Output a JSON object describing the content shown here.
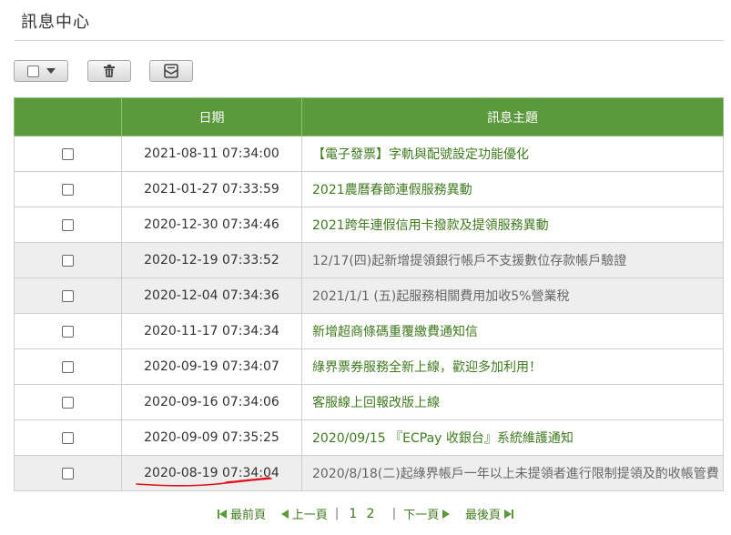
{
  "page": {
    "title": "訊息中心"
  },
  "table": {
    "headers": {
      "date": "日期",
      "subject": "訊息主題"
    },
    "rows": [
      {
        "date": "2021-08-11 07:34:00",
        "subject": "【電子發票】字軌與配號設定功能優化",
        "read": false
      },
      {
        "date": "2021-01-27 07:33:59",
        "subject": "2021農曆春節連假服務異動",
        "read": false
      },
      {
        "date": "2020-12-30 07:34:46",
        "subject": "2021跨年連假信用卡撥款及提領服務異動",
        "read": false
      },
      {
        "date": "2020-12-19 07:33:52",
        "subject": "12/17(四)起新增提領銀行帳戶不支援數位存款帳戶驗證",
        "read": true
      },
      {
        "date": "2020-12-04 07:34:36",
        "subject": "2021/1/1 (五)起服務相關費用加收5%營業稅",
        "read": true
      },
      {
        "date": "2020-11-17 07:34:34",
        "subject": "新增超商條碼重覆繳費通知信",
        "read": false
      },
      {
        "date": "2020-09-19 07:34:07",
        "subject": "綠界票券服務全新上線，歡迎多加利用！",
        "read": false
      },
      {
        "date": "2020-09-16 07:34:06",
        "subject": "客服線上回報改版上線",
        "read": false
      },
      {
        "date": "2020-09-09 07:35:25",
        "subject": "2020/09/15 『ECPay 收銀台』系統維護通知",
        "read": false
      },
      {
        "date": "2020-08-19 07:34:04",
        "subject": "2020/8/18(二)起綠界帳戶一年以上未提領者進行限制提領及酌收帳管費",
        "read": true
      }
    ]
  },
  "pager": {
    "first": "最前頁",
    "prev": "上一頁",
    "pages": [
      "1",
      "2"
    ],
    "next": "下一頁",
    "last": "最後頁",
    "separator": "|"
  },
  "colors": {
    "header_green": "#5a9a3c",
    "link_green": "#3f7a1f",
    "annotation_red": "#e0101a"
  },
  "icons": {
    "select_all": "checkbox-dropdown-icon",
    "delete": "trash-icon",
    "mark_read": "envelope-icon"
  }
}
